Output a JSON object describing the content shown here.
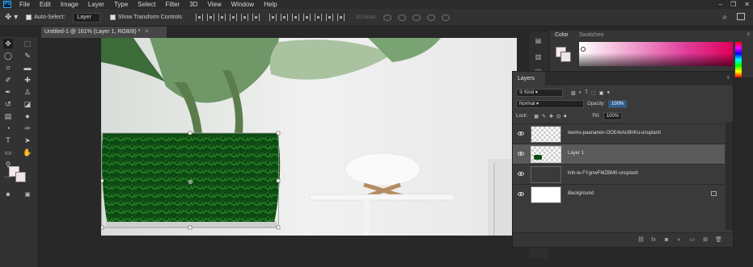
{
  "menubar": {
    "logo": "Ps",
    "items": [
      "File",
      "Edit",
      "Image",
      "Layer",
      "Type",
      "Select",
      "Filter",
      "3D",
      "View",
      "Window",
      "Help"
    ],
    "window_controls": [
      "–",
      "❐",
      "✕"
    ]
  },
  "options": {
    "auto_select_label": "Auto-Select:",
    "auto_select_value": "Layer",
    "transform_controls_label": "Show Transform Controls",
    "mode_3d_label": "3D Mode:"
  },
  "document": {
    "tab_title": "Untitled-1 @ 161% (Layer 1, RGB/8) *",
    "close_glyph": "×"
  },
  "color_panel": {
    "tabs": [
      "Color",
      "Swatches"
    ],
    "fg_color": "#f4eaea",
    "bg_color": "#ede4e4"
  },
  "layers_panel": {
    "tab_label": "Layers",
    "filter_label": "Kind",
    "blend_mode": "Normal",
    "opacity_label": "Opacity:",
    "opacity_value": "100%",
    "lock_label": "Lock:",
    "fill_label": "Fill:",
    "fill_value": "100%",
    "layers": [
      {
        "name": "teemu-paananen-OOE4xAnBhKo-unsplash",
        "selected": false,
        "italic": false,
        "thumb": "transparent",
        "locked": false
      },
      {
        "name": "Layer 1",
        "selected": true,
        "italic": false,
        "thumb": "transparent",
        "locked": false
      },
      {
        "name": "linh-le-FYgnwFMZBM0-unsplash",
        "selected": false,
        "italic": false,
        "thumb": "photo",
        "locked": false
      },
      {
        "name": "Background",
        "selected": false,
        "italic": true,
        "thumb": "white",
        "locked": true
      }
    ],
    "footer_icons": [
      "link-icon",
      "fx-icon",
      "mask-icon",
      "adjustment-icon",
      "group-icon",
      "new-layer-icon",
      "trash-icon"
    ]
  },
  "toolbar": {
    "tools": [
      "move-tool",
      "marquee-tool",
      "lasso-tool",
      "quick-select-tool",
      "crop-tool",
      "frame-tool",
      "eyedropper-tool",
      "healing-tool",
      "brush-tool",
      "stamp-tool",
      "history-brush-tool",
      "eraser-tool",
      "gradient-tool",
      "blur-tool",
      "dodge-tool",
      "pen-tool",
      "type-tool",
      "path-select-tool",
      "rectangle-tool",
      "hand-tool",
      "zoom-tool",
      "more-tools"
    ]
  }
}
